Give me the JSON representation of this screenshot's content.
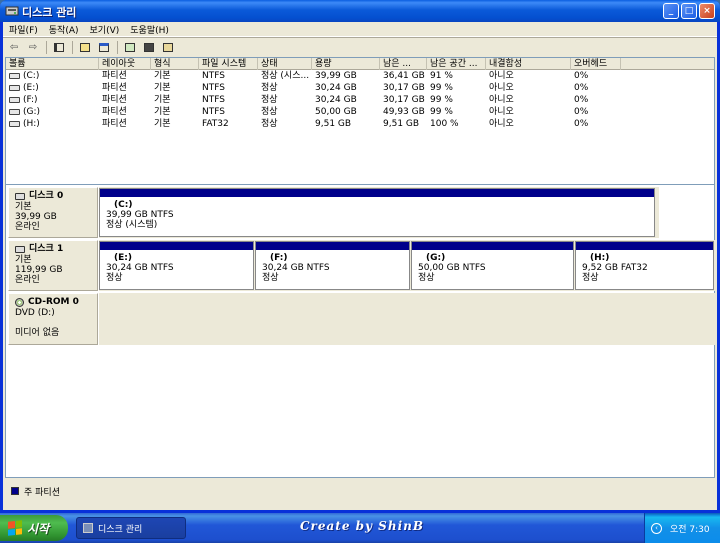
{
  "window": {
    "title": "디스크 관리"
  },
  "titlebar_buttons": {
    "minimize": "_",
    "maximize": "□",
    "close": "×"
  },
  "menu": [
    "파일(F)",
    "동작(A)",
    "보기(V)",
    "도움말(H)"
  ],
  "volume_table": {
    "columns": [
      "볼륨",
      "레이아웃",
      "형식",
      "파일 시스템",
      "상태",
      "용량",
      "남은 ...",
      "남은 공간 ...",
      "내결함성",
      "오버헤드"
    ],
    "rows": [
      [
        "(C:)",
        "파티션",
        "기본",
        "NTFS",
        "정상 (시스...",
        "39,99 GB",
        "36,41 GB",
        "91 %",
        "아니오",
        "0%"
      ],
      [
        "(E:)",
        "파티션",
        "기본",
        "NTFS",
        "정상",
        "30,24 GB",
        "30,17 GB",
        "99 %",
        "아니오",
        "0%"
      ],
      [
        "(F:)",
        "파티션",
        "기본",
        "NTFS",
        "정상",
        "30,24 GB",
        "30,17 GB",
        "99 %",
        "아니오",
        "0%"
      ],
      [
        "(G:)",
        "파티션",
        "기본",
        "NTFS",
        "정상",
        "50,00 GB",
        "49,93 GB",
        "99 %",
        "아니오",
        "0%"
      ],
      [
        "(H:)",
        "파티션",
        "기본",
        "FAT32",
        "정상",
        "9,51 GB",
        "9,51 GB",
        "100 %",
        "아니오",
        "0%"
      ]
    ]
  },
  "disks": [
    {
      "name": "디스크 0",
      "type": "기본",
      "size": "39,99 GB",
      "status": "온라인",
      "partitions": [
        {
          "name": "(C:)",
          "info": "39,99 GB NTFS",
          "status": "정상 (시스템)"
        }
      ]
    },
    {
      "name": "디스크 1",
      "type": "기본",
      "size": "119,99 GB",
      "status": "온라인",
      "partitions": [
        {
          "name": "(E:)",
          "info": "30,24 GB NTFS",
          "status": "정상"
        },
        {
          "name": "(F:)",
          "info": "30,24 GB NTFS",
          "status": "정상"
        },
        {
          "name": "(G:)",
          "info": "50,00 GB NTFS",
          "status": "정상"
        },
        {
          "name": "(H:)",
          "info": "9,52 GB FAT32",
          "status": "정상"
        }
      ]
    },
    {
      "name": "CD-ROM 0",
      "type": "DVD (D:)",
      "size": "",
      "status": "미디어 없음",
      "partitions": []
    }
  ],
  "legend": {
    "label": "주 파티션",
    "color": "#00008b"
  },
  "taskbar": {
    "start_label": "시작",
    "task_label": "디스크 관리",
    "center_text": "Create by ShinB",
    "clock": "오전 7:30"
  },
  "colors": {
    "partition_bar": "#00008b",
    "title_blue": "#0a5ee0",
    "start_green": "#3c9a3c"
  }
}
